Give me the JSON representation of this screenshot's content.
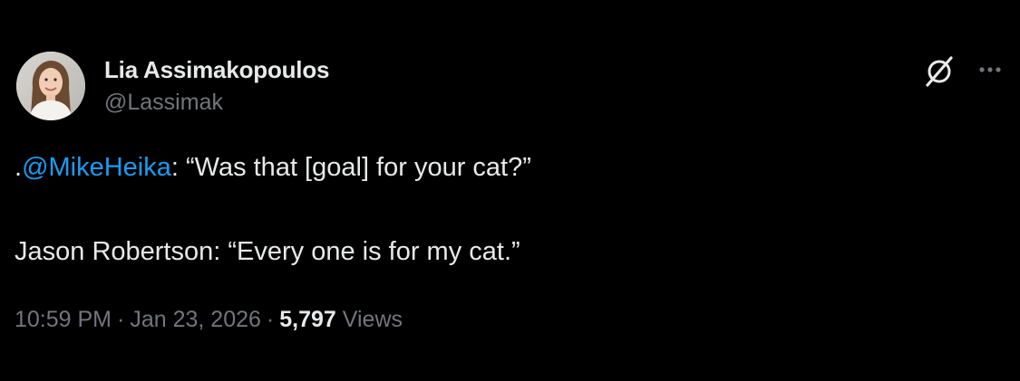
{
  "author": {
    "display_name": "Lia Assimakopoulos",
    "handle": "@Lassimak"
  },
  "tweet": {
    "line1_prefix": ".",
    "line1_mention": "@MikeHeika",
    "line1_rest": ": “Was that [goal] for your cat?”",
    "line2": "Jason Robertson: “Every one is for my cat.”"
  },
  "meta": {
    "time": "10:59 PM",
    "separator": "·",
    "date": "Jan 23, 2026",
    "views_count": "5,797",
    "views_label": "Views"
  },
  "icons": {
    "grok": "grok-icon",
    "more": "more-horizontal-icon"
  },
  "colors": {
    "background": "#000000",
    "text": "#e7e9ea",
    "secondary_text": "#71767b",
    "link": "#1d9bf0"
  }
}
